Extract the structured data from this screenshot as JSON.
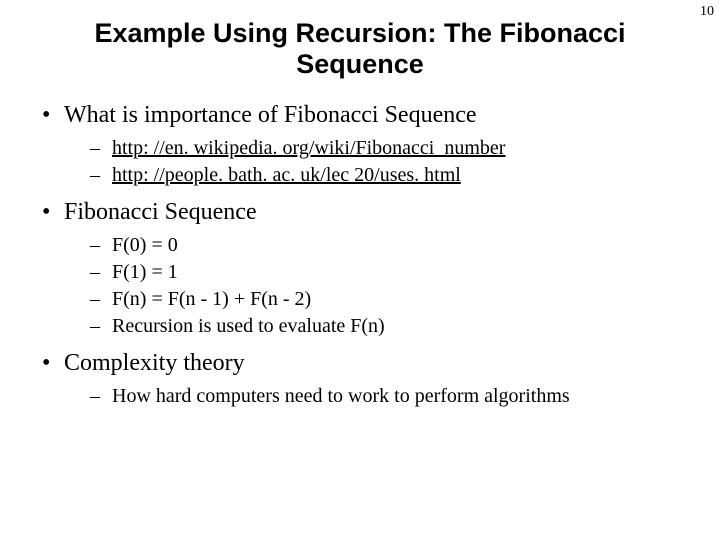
{
  "page_number": "10",
  "title": "Example Using Recursion: The Fibonacci Sequence",
  "bullets": [
    {
      "text": "What is importance of Fibonacci Sequence",
      "sub": [
        {
          "text": "http: //en. wikipedia. org/wiki/Fibonacci_number",
          "link": true
        },
        {
          "text": "http: //people. bath. ac. uk/lec 20/uses. html",
          "link": true
        }
      ]
    },
    {
      "text": "Fibonacci Sequence",
      "sub": [
        {
          "text": "F(0) = 0"
        },
        {
          "text": "F(1) = 1"
        },
        {
          "text": "F(n) = F(n - 1) + F(n - 2)"
        },
        {
          "text": "Recursion is used to evaluate F(n)"
        }
      ]
    },
    {
      "text": "Complexity theory",
      "sub": [
        {
          "text": "How hard computers need to work to perform algorithms"
        }
      ]
    }
  ]
}
